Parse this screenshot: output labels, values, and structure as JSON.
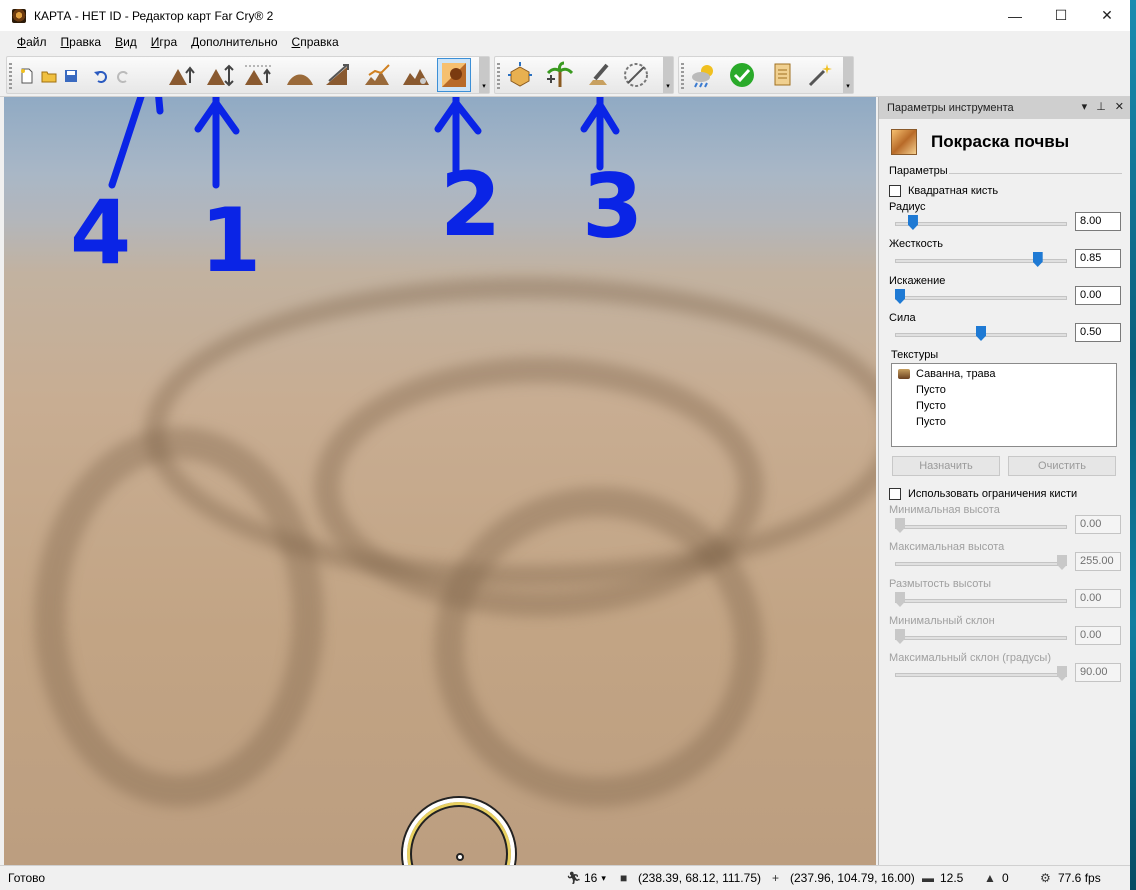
{
  "window": {
    "title": "КАРТА - НЕТ ID - Редактор карт Far Cry® 2",
    "minimize": "—",
    "maximize": "☐",
    "close": "✕"
  },
  "menu": [
    "Файл",
    "Правка",
    "Вид",
    "Игра",
    "Дополнительно",
    "Справка"
  ],
  "toolbar": {
    "active_tool": "paint-terrain-button"
  },
  "annotations": [
    "4",
    "1",
    "2",
    "3"
  ],
  "panel": {
    "header": "Параметры инструмента",
    "tool_title": "Покраска почвы",
    "params_section": "Параметры",
    "square_brush": "Квадратная кисть",
    "radius": {
      "label": "Радиус",
      "value": "8.00",
      "level": 0.08
    },
    "hardness": {
      "label": "Жесткость",
      "value": "0.85",
      "level": 0.85
    },
    "distortion": {
      "label": "Искажение",
      "value": "0.00",
      "level": 0.0
    },
    "strength": {
      "label": "Сила",
      "value": "0.50",
      "level": 0.5
    },
    "textures_label": "Текстуры",
    "textures": [
      "Саванна, трава",
      "Пусто",
      "Пусто",
      "Пусто"
    ],
    "assign_button": "Назначить",
    "clear_button": "Очистить",
    "use_constraints": "Использовать ограничения кисти",
    "min_height": {
      "label": "Минимальная высота",
      "value": "0.00",
      "level": 0.0
    },
    "max_height": {
      "label": "Максимальная высота",
      "value": "255.00",
      "level": 1.0
    },
    "height_blur": {
      "label": "Размытость высоты",
      "value": "0.00",
      "level": 0.0
    },
    "min_slope": {
      "label": "Минимальный склон",
      "value": "0.00",
      "level": 0.0
    },
    "max_slope": {
      "label": "Максимальный склон (градусы)",
      "value": "90.00",
      "level": 1.0
    }
  },
  "status": {
    "ready": "Готово",
    "speed": "16",
    "camera_pos": "(238.39, 68.12, 111.75)",
    "cursor_pos": "(237.96, 104.79, 16.00)",
    "memory": "12.5",
    "objects": "0",
    "fps": "77.6 fps"
  }
}
